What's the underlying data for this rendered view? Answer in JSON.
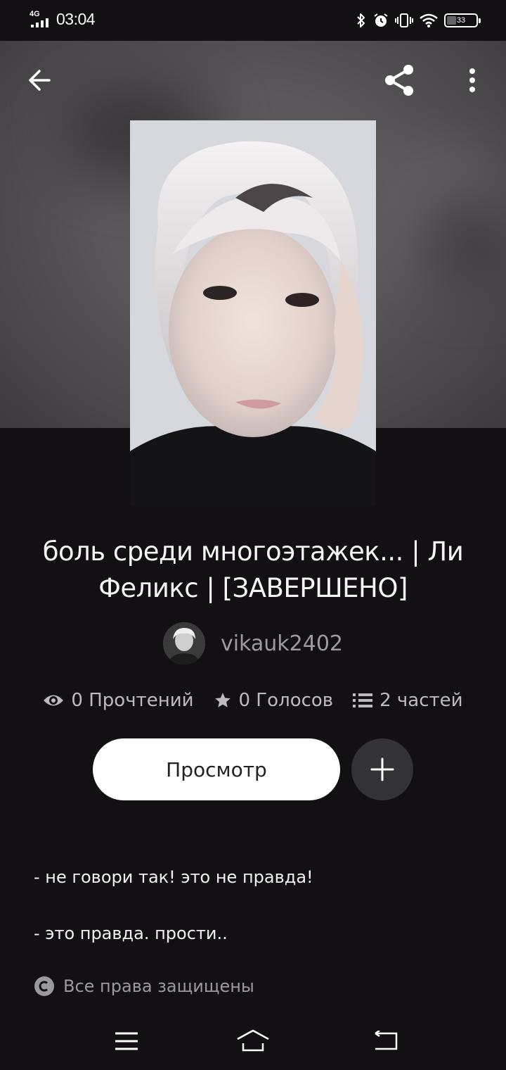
{
  "status_bar": {
    "network": "4G",
    "time": "03:04",
    "battery": "33",
    "icons": [
      "bluetooth-icon",
      "alarm-icon",
      "vibrate-icon",
      "wifi-icon",
      "battery-icon"
    ]
  },
  "toolbar": {
    "back_icon": "arrow-left-icon",
    "share_icon": "share-icon",
    "menu_icon": "more-vertical-icon"
  },
  "story": {
    "title": "боль среди многоэтажек... | Ли Феликс | [ЗАВЕРШЕНО]",
    "author": "vikauk2402",
    "stats": {
      "reads": "0 Прочтений",
      "votes": "0 Голосов",
      "parts": "2 частей"
    },
    "read_button": "Просмотр",
    "description_lines": [
      "- не говори так! это не правда!",
      "- это правда. прости.."
    ],
    "copyright": "Все права защищены"
  },
  "colors": {
    "background": "#121013",
    "hero": "#5a575a",
    "button": "#ffffff",
    "add_button": "#333236",
    "muted_text": "#9c9b9e"
  }
}
